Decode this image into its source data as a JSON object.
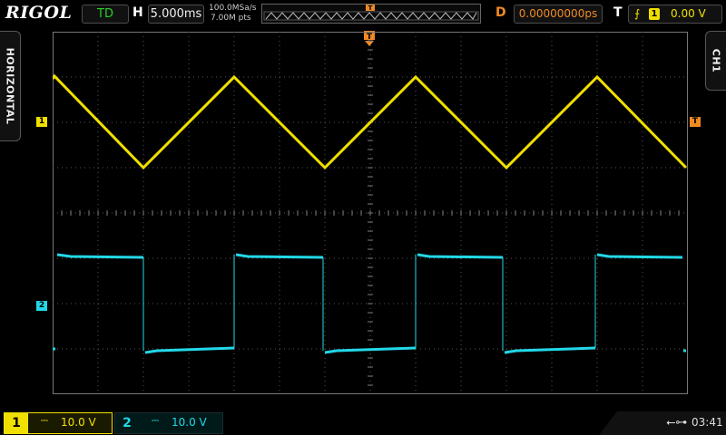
{
  "header": {
    "brand": "RIGOL",
    "run_status": "TD",
    "horizontal_label": "H",
    "timebase": "5.000ms",
    "sample_rate": "100.0MSa/s",
    "memory_depth": "7.00M pts",
    "delay_label": "D",
    "delay": "0.00000000ps",
    "trigger_label": "T",
    "trigger_source": "1",
    "trigger_level": "0.00 V"
  },
  "side_tabs": {
    "left": "HORIZONTAL",
    "right": "CH1"
  },
  "markers": {
    "trigger_top": "T",
    "trigger_right": "T",
    "ch1": "1",
    "ch2": "2"
  },
  "channels": [
    {
      "number": "1",
      "coupling": "⎓",
      "scale": "10.0 V",
      "color": "#f0e000"
    },
    {
      "number": "2",
      "coupling": "⎓",
      "scale": "10.0 V",
      "color": "#22d8e8"
    }
  ],
  "footer": {
    "usb_icon": "usb-icon",
    "time": "03:41"
  },
  "colors": {
    "ch1": "#f0e000",
    "ch2": "#22d8e8",
    "trigger": "#f08a24",
    "grid": "#555555"
  }
}
